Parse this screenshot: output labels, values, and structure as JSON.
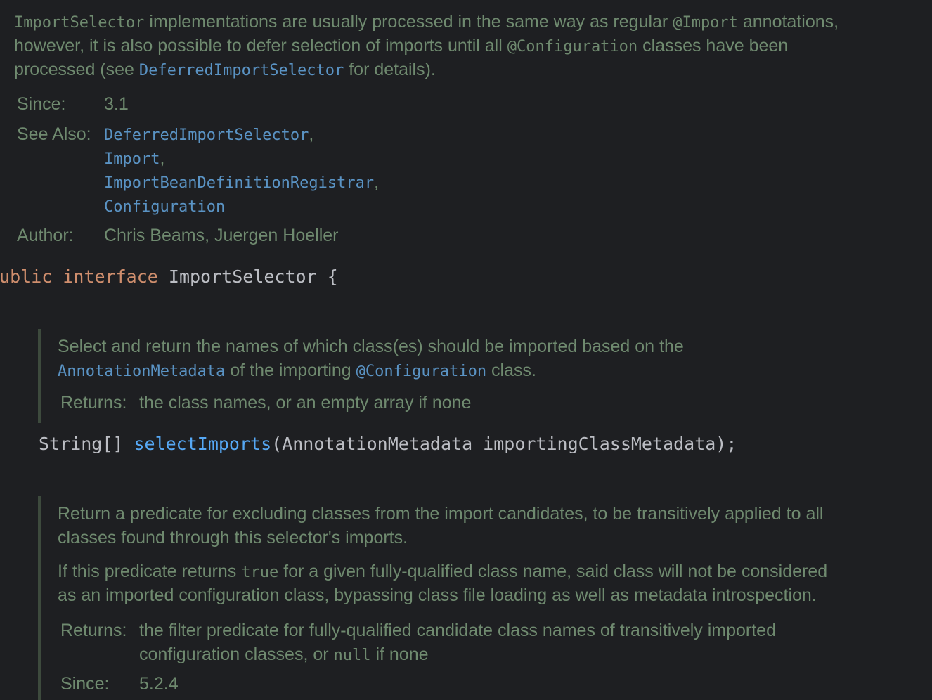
{
  "class_doc": {
    "p1": {
      "code1": "ImportSelector",
      "t1": " implementations are usually processed in the same way as regular ",
      "code2": "@Import",
      "t2": " annotations,",
      "t3": "however, it is also possible to defer selection of imports until all ",
      "code3": "@Configuration",
      "t4": " classes have been",
      "t5": "processed (see ",
      "link1": "DeferredImportSelector",
      "t6": " for details)."
    },
    "since_label": "Since:",
    "since_value": "3.1",
    "see_also_label": "See Also:",
    "see_also": [
      {
        "name": "DeferredImportSelector",
        "sep": ","
      },
      {
        "name": "Import",
        "sep": ","
      },
      {
        "name": "ImportBeanDefinitionRegistrar",
        "sep": ","
      },
      {
        "name": "Configuration",
        "sep": ""
      }
    ],
    "author_label": "Author:",
    "author_value": "Chris Beams, Juergen Hoeller"
  },
  "declaration": {
    "kw_public": "public",
    "kw_interface": "interface",
    "name": "ImportSelector",
    "brace": "{"
  },
  "method1_doc": {
    "t1": "Select and return the names of which class(es) should be imported based on the",
    "link1": "AnnotationMetadata",
    "t2": " of the importing ",
    "link2": "@Configuration",
    "t3": " class.",
    "returns_label": "Returns:",
    "returns_value": "the class names, or an empty array if none"
  },
  "method1_sig": {
    "ret": "String[] ",
    "name": "selectImports",
    "params": "(AnnotationMetadata importingClassMetadata);"
  },
  "method2_doc": {
    "p1_l1": "Return a predicate for excluding classes from the import candidates, to be transitively applied to all",
    "p1_l2": "classes found through this selector's imports.",
    "p2_t1": "If this predicate returns ",
    "p2_code": "true",
    "p2_t2": " for a given fully-qualified class name, said class will not be considered",
    "p2_l2": "as an imported configuration class, bypassing class file loading as well as metadata introspection.",
    "returns_label": "Returns:",
    "returns_l1": "the filter predicate for fully-qualified candidate class names of transitively imported",
    "returns_l2_t1": "configuration classes, or ",
    "returns_l2_code": "null",
    "returns_l2_t2": " if none",
    "since_label": "Since:",
    "since_value": "5.2.4"
  },
  "colors": {
    "background": "#1e1f22",
    "doc_text": "#6f8a6f",
    "link": "#5a93c4",
    "keyword": "#cf8e6d",
    "identifier": "#bcbec4",
    "method": "#56a8f5"
  }
}
